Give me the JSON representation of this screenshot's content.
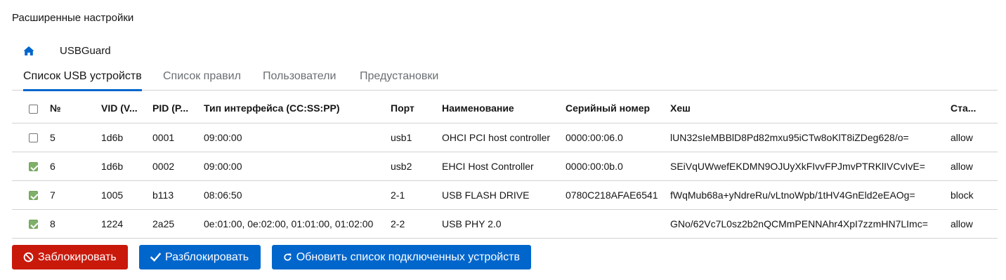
{
  "page": {
    "title": "Расширенные настройки"
  },
  "breadcrumb": {
    "label": "USBGuard"
  },
  "tabs": [
    {
      "label": "Список USB устройств",
      "active": true
    },
    {
      "label": "Список правил",
      "active": false
    },
    {
      "label": "Пользователи",
      "active": false
    },
    {
      "label": "Предустановки",
      "active": false
    }
  ],
  "table": {
    "select_all_checked": false,
    "headers": {
      "num": "№",
      "vid": "VID (V...",
      "pid": "PID (P...",
      "iface": "Тип интерфейса (CC:SS:PP)",
      "port": "Порт",
      "name": "Наименование",
      "serial": "Серийный номер",
      "hash": "Хеш",
      "status": "Ста..."
    },
    "rows": [
      {
        "checked": false,
        "num": "5",
        "vid": "1d6b",
        "pid": "0001",
        "iface": "09:00:00",
        "port": "usb1",
        "name": "OHCI PCI host controller",
        "serial": "0000:00:06.0",
        "hash": "lUN32sIeMBBlD8Pd82mxu95iCTw8oKlT8iZDeg628/o=",
        "status": "allow"
      },
      {
        "checked": true,
        "num": "6",
        "vid": "1d6b",
        "pid": "0002",
        "iface": "09:00:00",
        "port": "usb2",
        "name": "EHCI Host Controller",
        "serial": "0000:00:0b.0",
        "hash": "SEiVqUWwefEKDMN9OJUyXkFIvvFPJmvPTRKlIVCvIvE=",
        "status": "allow"
      },
      {
        "checked": true,
        "num": "7",
        "vid": "1005",
        "pid": "b113",
        "iface": "08:06:50",
        "port": "2-1",
        "name": "USB FLASH DRIVE",
        "serial": "0780C218AFAE6541",
        "hash": "fWqMub68a+yNdreRu/vLtnoWpb/1tHV4GnEld2eEAOg=",
        "status": "block"
      },
      {
        "checked": true,
        "num": "8",
        "vid": "1224",
        "pid": "2a25",
        "iface": "0e:01:00, 0e:02:00, 01:01:00, 01:02:00",
        "port": "2-2",
        "name": "USB PHY 2.0",
        "serial": "",
        "hash": "GNo/62Vc7L0sz2b2nQCMmPENNAhr4XpI7zzmHN7LImc=",
        "status": "allow"
      }
    ]
  },
  "actions": {
    "block_label": "Заблокировать",
    "unblock_label": "Разблокировать",
    "refresh_label": "Обновить список подключенных устройств"
  },
  "colors": {
    "primary": "#0066cc",
    "danger": "#c9190b",
    "checkbox_checked": "#7fb069"
  },
  "icons": {
    "home": "home-icon",
    "block": "ban-icon",
    "unblock": "check-icon",
    "refresh": "refresh-icon"
  }
}
